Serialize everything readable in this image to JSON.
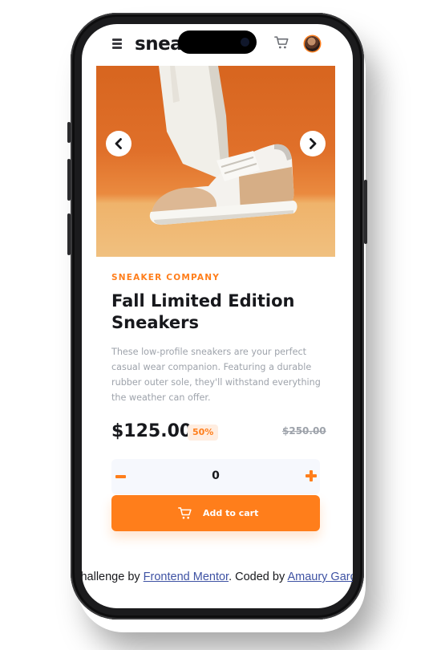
{
  "header": {
    "logo_text": "sneakers",
    "menu_icon": "hamburger-icon",
    "cart_icon": "cart-icon",
    "avatar": "user-avatar"
  },
  "gallery": {
    "prev_icon": "chevron-left-icon",
    "next_icon": "chevron-right-icon",
    "image": "sneaker-product-photo"
  },
  "product": {
    "company": "SNEAKER COMPANY",
    "title": "Fall Limited Edition Sneakers",
    "description": "These low-profile sneakers are your perfect casual wear companion. Featuring a durable rubber outer sole, they'll withstand everything the weather can offer.",
    "price": "$125.00",
    "discount": "50%",
    "original_price": "$250.00"
  },
  "quantity": {
    "value": "0",
    "minus_icon": "minus-icon",
    "plus_icon": "plus-icon"
  },
  "cart_button": {
    "label": "Add to cart",
    "icon": "cart-icon"
  },
  "attribution": {
    "prefix": "Challenge by ",
    "link1": "Frontend Mentor",
    "middle": ". Coded by ",
    "link2": "Amaury Garcia"
  },
  "colors": {
    "accent": "#ff7e1b",
    "accent_light": "#ffede0",
    "text_dark": "#17181c",
    "text_muted": "#9ea3ab",
    "link": "#3e52a3",
    "quantity_bg": "#f6f8fd"
  }
}
